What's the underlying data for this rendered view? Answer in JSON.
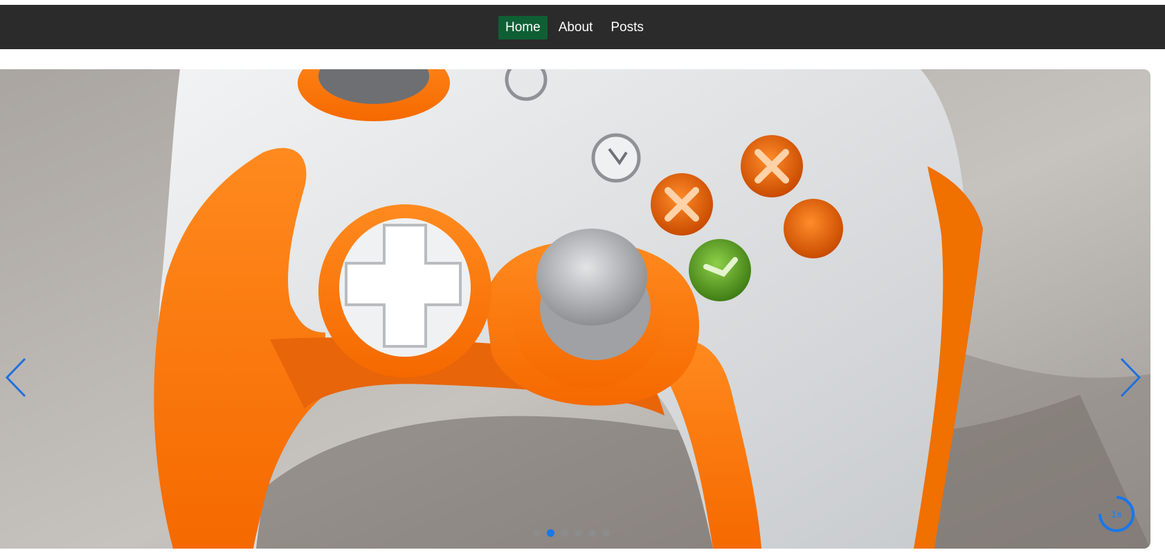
{
  "nav": {
    "items": [
      {
        "label": "Home",
        "active": true
      },
      {
        "label": "About",
        "active": false
      },
      {
        "label": "Posts",
        "active": false
      }
    ]
  },
  "carousel": {
    "image": "orange-white-game-controller",
    "prev_icon": "chevron-left-icon",
    "next_icon": "chevron-right-icon",
    "slide_count": 6,
    "active_index": 1,
    "timer_label": "1s",
    "timer_progress": 0.75
  },
  "colors": {
    "topbar": "#2b2b2b",
    "nav_active": "#0f5f34",
    "accent": "#1877ea",
    "controller_orange": "#ff7a10",
    "controller_white": "#e7e8ea"
  }
}
